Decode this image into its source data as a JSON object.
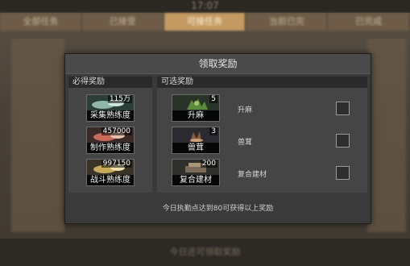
{
  "background": {
    "clock": "17:07",
    "tabs": [
      "全部任务",
      "已接受",
      "可接任务",
      "当前已完",
      "已完成"
    ],
    "bottom_text": "今日还可领取奖励"
  },
  "dialog": {
    "title": "领取奖励",
    "required": {
      "header": "必得奖励",
      "items": [
        {
          "label": "采集熟练度",
          "count": "115万",
          "icon": "gather-proficiency-icon",
          "color": "#8fb8a8"
        },
        {
          "label": "制作熟练度",
          "count": "457000",
          "icon": "craft-proficiency-icon",
          "color": "#c86a5a"
        },
        {
          "label": "战斗熟练度",
          "count": "997150",
          "icon": "combat-proficiency-icon",
          "color": "#c8a85a"
        }
      ]
    },
    "optional": {
      "header": "可选奖励",
      "items": [
        {
          "label": "升麻",
          "count": "5",
          "name": "升麻",
          "icon": "herb-icon",
          "color": "#5a8a3a",
          "checked": false
        },
        {
          "label": "兽茸",
          "count": "3",
          "name": "兽茸",
          "icon": "antler-icon",
          "color": "#8a5a3a",
          "checked": false
        },
        {
          "label": "复合建材",
          "count": "200",
          "name": "复合建材",
          "icon": "building-material-icon",
          "color": "#7a6a5a",
          "checked": false
        }
      ]
    },
    "footer": "今日执勤点达到80可获得以上奖励"
  }
}
